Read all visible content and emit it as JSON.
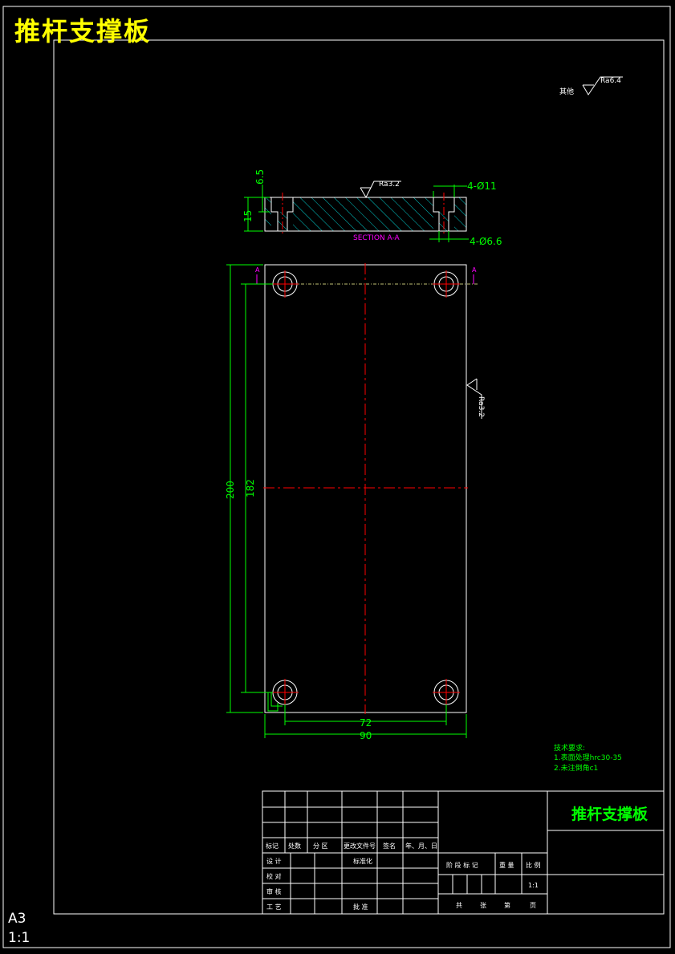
{
  "drawing_title": "推杆支撑板",
  "surface_note": {
    "prefix": "其他",
    "value": "Ra6.4"
  },
  "section": {
    "label": "SECTION A-A",
    "roughness": "Ra3.2",
    "dim_top": "6.5",
    "dim_thickness": "15",
    "callout_counterbore": "4-Ø11",
    "callout_hole": "4-Ø6.6"
  },
  "plan": {
    "cut_mark": "A",
    "dim_length": "200",
    "dim_hole_spacing_v": "182",
    "dim_hole_spacing_h": "72",
    "dim_width": "90",
    "roughness": "Ra3.2"
  },
  "tech_req": {
    "heading": "技术要求:",
    "items": [
      "1.表面处理hrc30-35",
      "2.未注倒角c1"
    ]
  },
  "title_block": {
    "name": "推杆支撑板",
    "rev_headers": [
      "标记",
      "处数",
      "分 区",
      "更改文件号",
      "签名",
      "年、月、日"
    ],
    "roles": [
      "设 计",
      "校 对",
      "审 核",
      "工 艺"
    ],
    "standardize": "标准化",
    "approve": "批 准",
    "stage_headers": [
      "阶 段 标 记",
      "重 量",
      "比 例"
    ],
    "scale": "1:1",
    "sheet_labels": [
      "共",
      "张",
      "第",
      "页"
    ]
  },
  "paper": {
    "size": "A3",
    "scale": "1:1"
  },
  "colors": {
    "line": "#ffffff",
    "dim": "#00ff00",
    "center": "#ff0000",
    "section_label": "#ff00ff",
    "hatch": "#00ffff",
    "title": "#ffff00"
  }
}
